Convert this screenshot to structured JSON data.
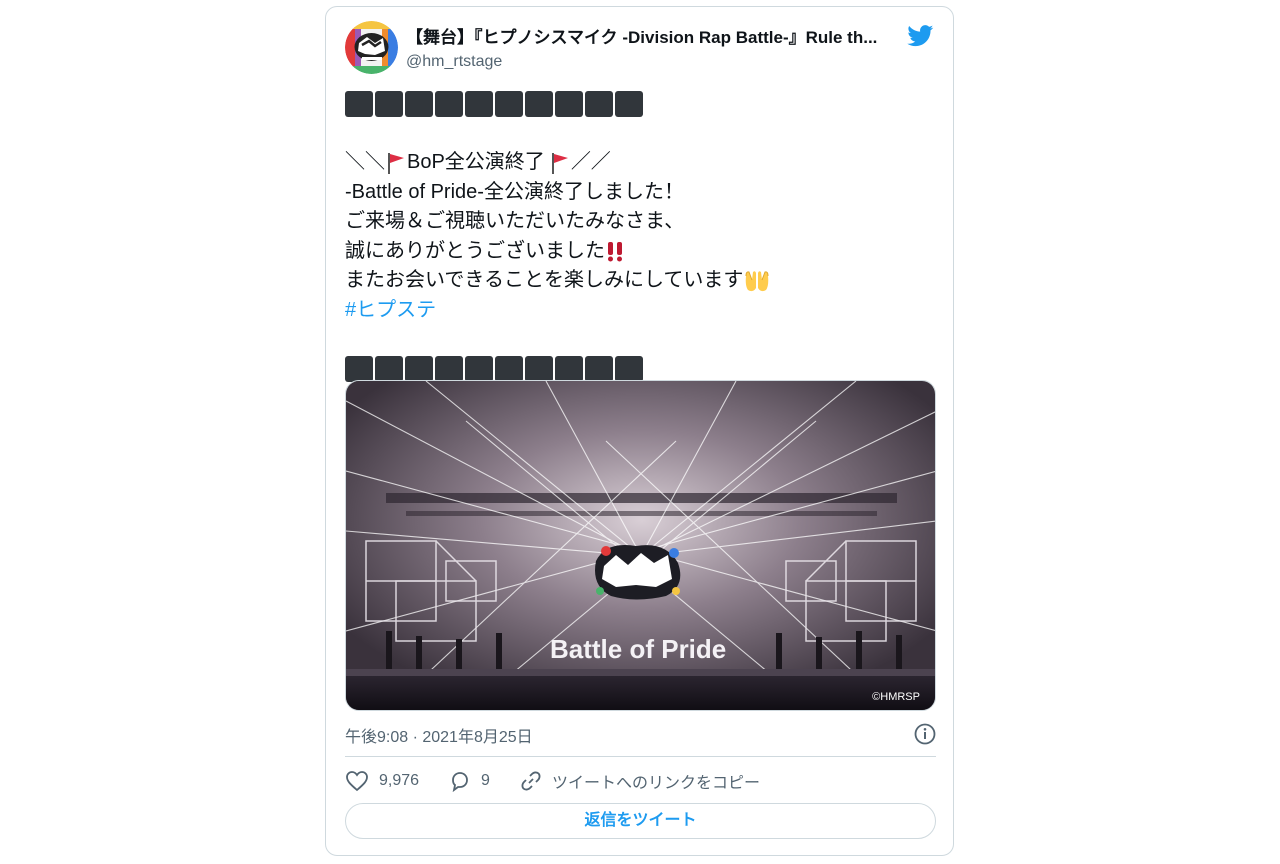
{
  "tweet": {
    "display_name": "【舞台】『ヒプノシスマイク -Division Rap Battle-』Rule th...",
    "handle": "@hm_rtstage",
    "text": {
      "block_count": 10,
      "line1_prefix": "＼＼",
      "line1_mid": "BoP全公演終了",
      "line1_suffix": "／／",
      "line2": "-Battle of Pride-全公演終了しました！",
      "line3": "ご来場＆ご視聴いただいたみなさま、",
      "line4": "誠にありがとうございました",
      "line5": "またお会いできることを楽しみにしています",
      "hashtag": "#ヒプステ"
    },
    "media": {
      "stage_text": "Battle of Pride",
      "copyright": "©HMRSP"
    },
    "timestamp": "午後9:08 · 2021年8月25日",
    "likes": "9,976",
    "replies": "9",
    "copy_link_label": "ツイートへのリンクをコピー",
    "reply_button_label": "返信をツイート"
  },
  "icons": [
    "avatar-logo",
    "twitter-bird-icon",
    "red-flag-icon",
    "double-exclamation-icon",
    "raising-hands-icon",
    "info-icon",
    "heart-icon",
    "comment-icon",
    "link-icon"
  ],
  "colors": {
    "accent": "#1d9bf0",
    "text": "#0f1419",
    "secondary": "#536471",
    "border": "#cfd9de",
    "block": "#31363b"
  }
}
